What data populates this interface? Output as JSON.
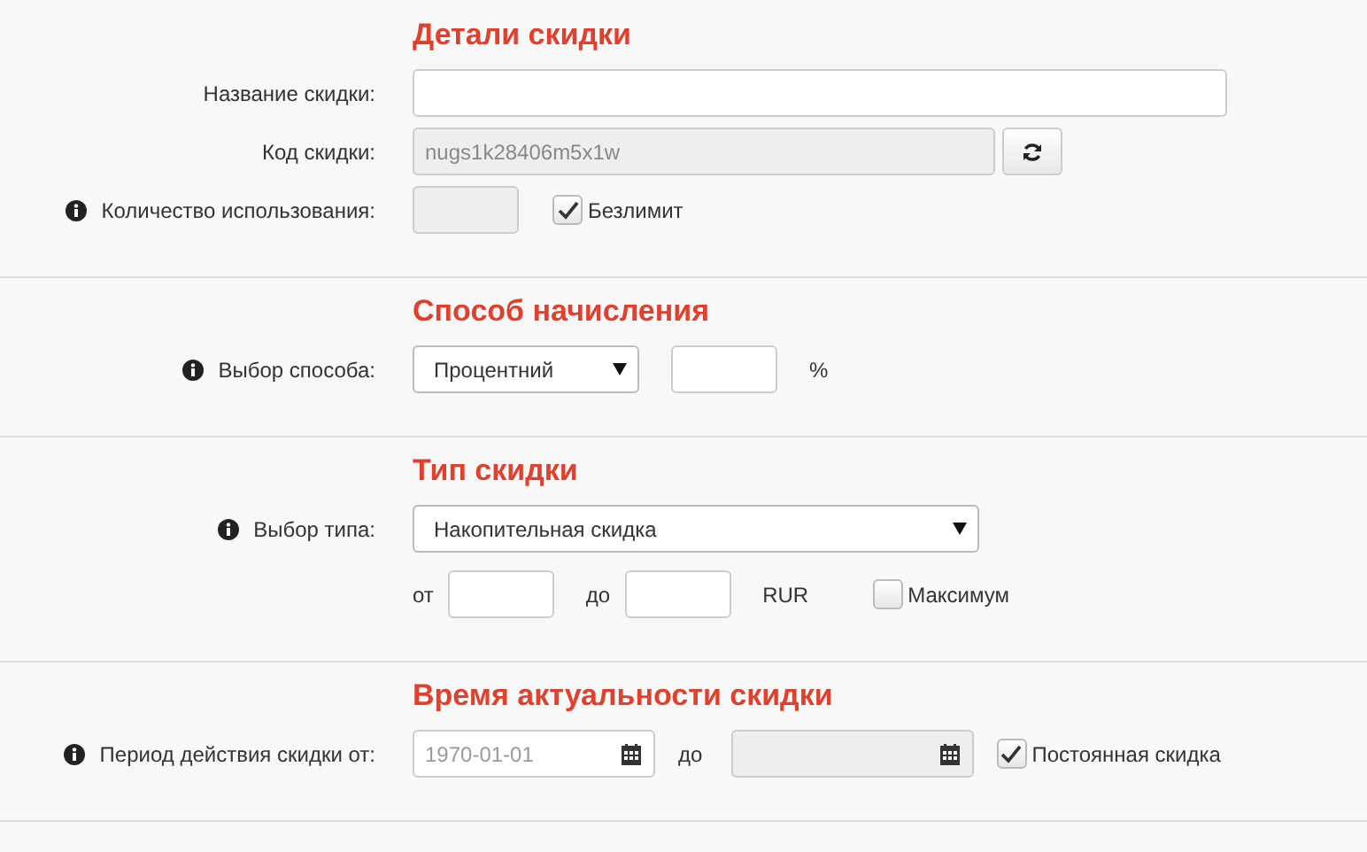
{
  "sections": [
    {
      "title": "Детали скидки",
      "rows": [
        {
          "label": "Название скидки:",
          "info": false,
          "controls": [
            {
              "kind": "field",
              "disabled": false
            }
          ]
        },
        {
          "label": "Код скидки:",
          "info": false,
          "controls": [
            {
              "kind": "code",
              "value": "nugs1k28406m5x1w",
              "disabled": true
            },
            {
              "kind": "refresh"
            }
          ]
        },
        {
          "label": "Количество использования:",
          "info": true,
          "controls": [
            {
              "kind": "number",
              "disabled": true
            },
            {
              "kind": "checkbox",
              "label": "Безлимит",
              "checked": true
            }
          ]
        }
      ]
    },
    {
      "title": "Способ начисления",
      "rows": [
        {
          "label": "Выбор способа:",
          "info": true,
          "controls": [
            {
              "kind": "select",
              "value": "Процентний"
            },
            {
              "kind": "number",
              "disabled": false
            },
            {
              "kind": "unit",
              "text": "%"
            }
          ]
        }
      ]
    },
    {
      "title": "Тип скидки",
      "rows": [
        {
          "label": "Выбор типа:",
          "info": true,
          "controls": [
            {
              "kind": "wide-select",
              "value": "Накопительная скидка"
            }
          ]
        },
        {
          "controls": [
            {
              "kind": "unit",
              "text": "от"
            },
            {
              "kind": "number",
              "disabled": false
            },
            {
              "kind": "unit",
              "text": "до"
            },
            {
              "kind": "number",
              "disabled": false
            },
            {
              "kind": "unit",
              "text": "RUR"
            },
            {
              "kind": "checkbox",
              "label": "Максимум",
              "checked": false
            }
          ]
        }
      ]
    },
    {
      "title": "Время актуальности скидки",
      "rows": [
        {
          "label": "Период действия скидки от:",
          "info": true,
          "controls": [
            {
              "kind": "date",
              "placeholder": "1970-01-01",
              "disabled": false
            },
            {
              "kind": "unit",
              "text": "до"
            },
            {
              "kind": "date",
              "disabled": true
            },
            {
              "kind": "checkbox",
              "label": "Постоянная скидка",
              "checked": true
            }
          ]
        }
      ]
    }
  ]
}
